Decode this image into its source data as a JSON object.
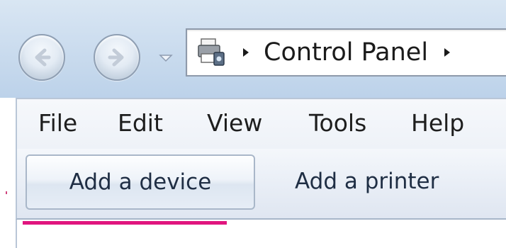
{
  "navigation": {
    "back_icon": "back-arrow-icon",
    "forward_icon": "forward-arrow-icon",
    "history_dropdown_icon": "chevron-down-icon"
  },
  "address_bar": {
    "location_icon": "devices-and-printers-icon",
    "breadcrumbs": [
      {
        "label": "Control Panel"
      }
    ]
  },
  "menubar": {
    "items": [
      {
        "label": "File"
      },
      {
        "label": "Edit"
      },
      {
        "label": "View"
      },
      {
        "label": "Tools"
      },
      {
        "label": "Help"
      }
    ]
  },
  "command_bar": {
    "add_device_label": "Add a device",
    "add_printer_label": "Add a printer"
  },
  "colors": {
    "highlight_underline": "#e0157e",
    "chrome_blue": "#c5d8ec"
  }
}
